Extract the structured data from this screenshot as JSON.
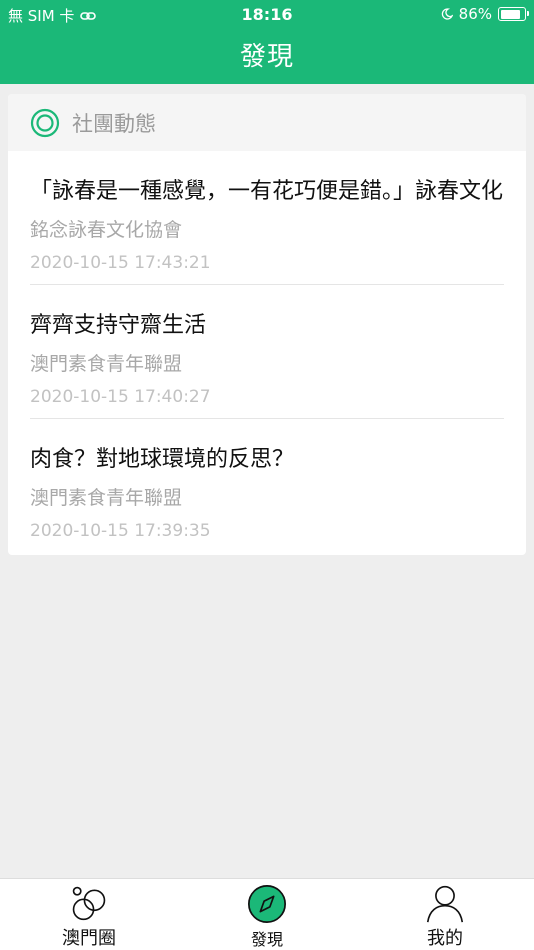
{
  "status_bar": {
    "carrier": "無 SIM 卡",
    "time": "18:16",
    "battery": "86%",
    "battery_level": 0.86
  },
  "header": {
    "title": "發現"
  },
  "section": {
    "title": "社團動態",
    "icon": "ring-icon"
  },
  "feed": [
    {
      "title": "「詠春是一種感覺，一有花巧便是錯。」詠春文化",
      "org": "銘念詠春文化協會",
      "time": "2020-10-15 17:43:21"
    },
    {
      "title": "齊齊支持守齋生活",
      "org": "澳門素食青年聯盟",
      "time": "2020-10-15 17:40:27"
    },
    {
      "title": "肉食？對地球環境的反思？",
      "org": "澳門素食青年聯盟",
      "time": "2020-10-15 17:39:35"
    }
  ],
  "tabbar": {
    "tabs": [
      {
        "label": "澳門圈",
        "icon": "circles-icon"
      },
      {
        "label": "發現",
        "icon": "compass-icon"
      },
      {
        "label": "我的",
        "icon": "person-icon"
      }
    ],
    "active_index": 1,
    "accent_color": "#1bb878"
  }
}
